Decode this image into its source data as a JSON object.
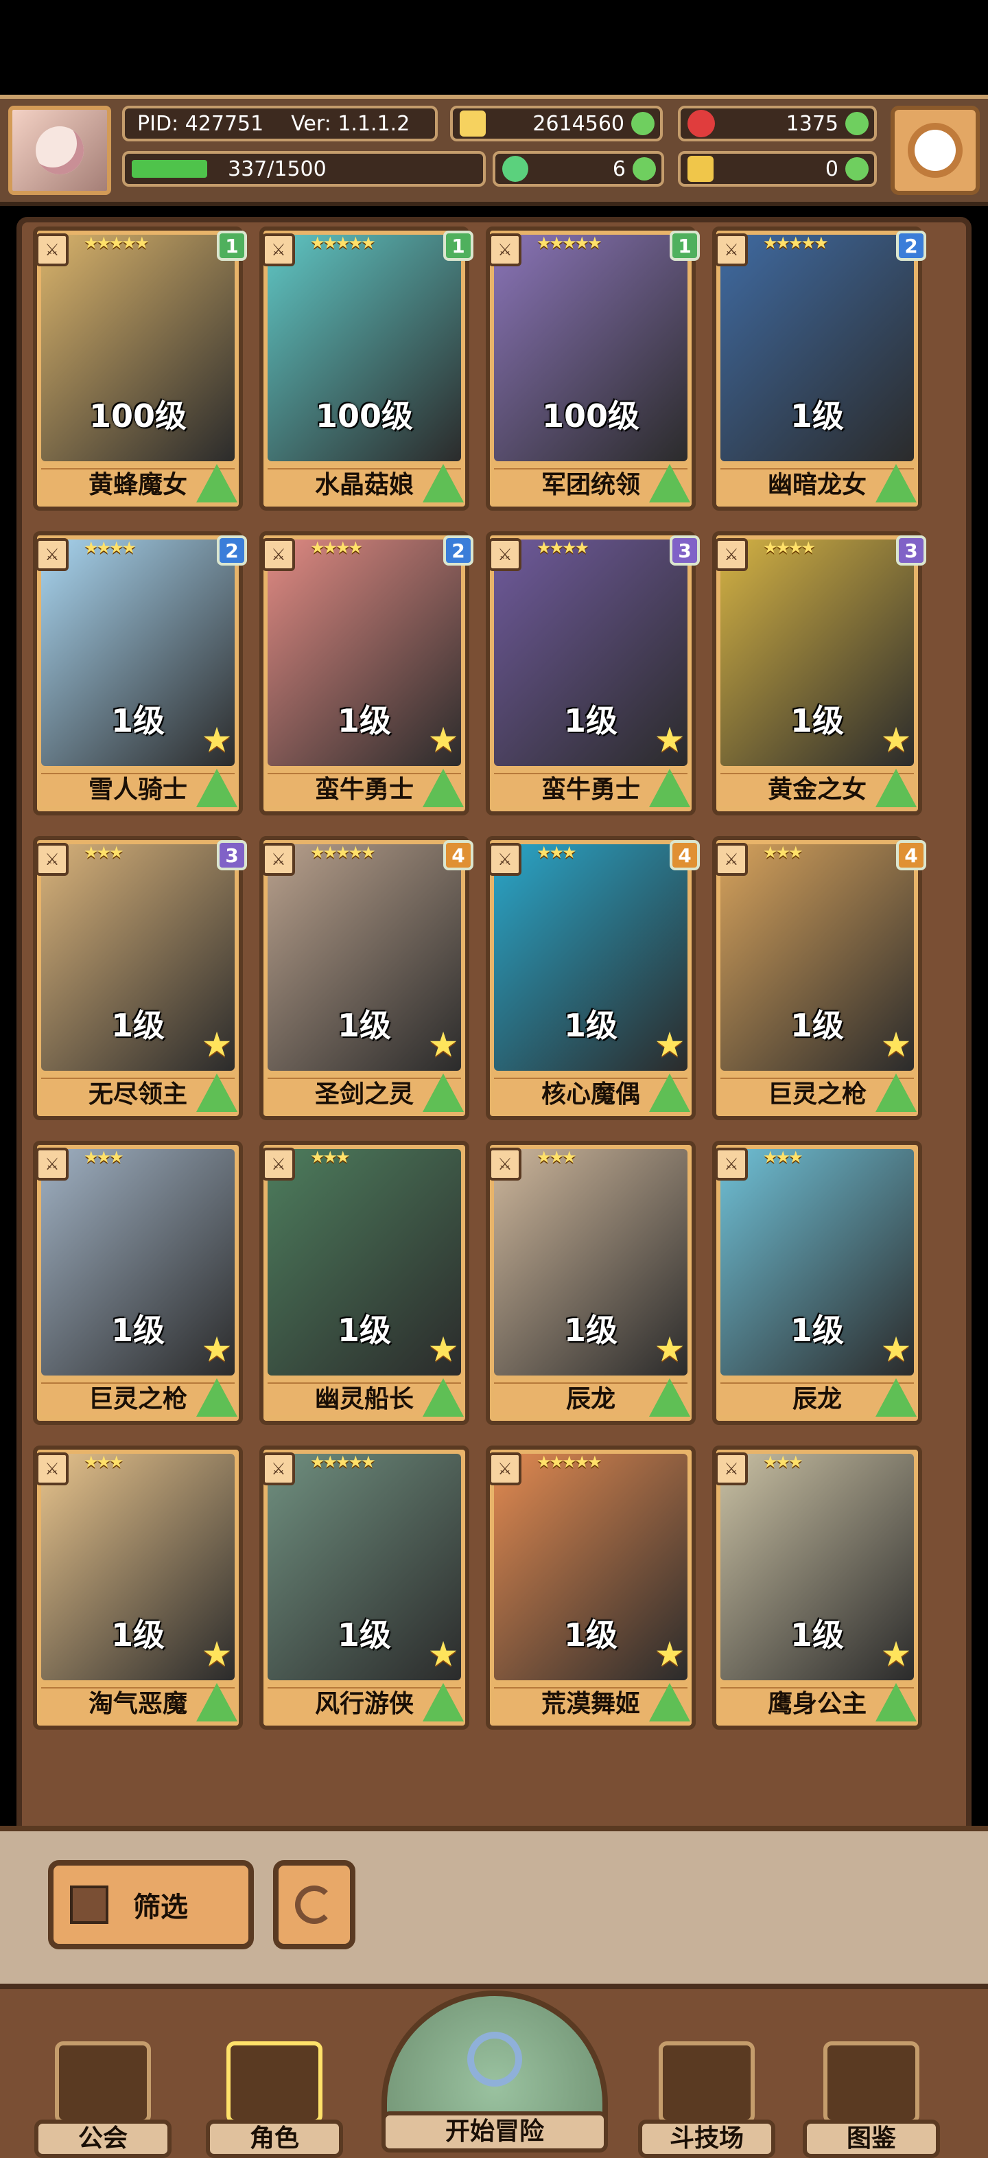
{
  "hud": {
    "pid": "PID: 427751",
    "version": "Ver: 1.1.1.2",
    "gold": "2614560",
    "gems": "1375",
    "energy": "337/1500",
    "clover": "6",
    "tickets": "0"
  },
  "cards": [
    {
      "level": "100级",
      "name": "黄蜂魔女",
      "badge": "1",
      "badge_color": "green",
      "stars": "★★★★★",
      "art": "#d9b36b"
    },
    {
      "level": "100级",
      "name": "水晶菇娘",
      "badge": "1",
      "badge_color": "green",
      "stars": "★★★★★",
      "art": "#5fc6c4"
    },
    {
      "level": "100级",
      "name": "军团统领",
      "badge": "1",
      "badge_color": "green",
      "stars": "★★★★★",
      "art": "#8a74b8"
    },
    {
      "level": "1级",
      "name": "幽暗龙女",
      "badge": "2",
      "badge_color": "blue",
      "stars": "★★★★★",
      "art": "#3f6aa1"
    },
    {
      "level": "1级",
      "name": "雪人骑士",
      "badge": "2",
      "badge_color": "blue",
      "stars": "★★★★",
      "art": "#a8d4ef"
    },
    {
      "level": "1级",
      "name": "蛮牛勇士",
      "badge": "2",
      "badge_color": "blue",
      "stars": "★★★★",
      "art": "#e08a83"
    },
    {
      "level": "1级",
      "name": "蛮牛勇士",
      "badge": "3",
      "badge_color": "purple",
      "stars": "★★★★",
      "art": "#6f5a9c"
    },
    {
      "level": "1级",
      "name": "黄金之女",
      "badge": "3",
      "badge_color": "purple",
      "stars": "★★★★",
      "art": "#d4b244"
    },
    {
      "level": "1级",
      "name": "无尽领主",
      "badge": "3",
      "badge_color": "purple",
      "stars": "★★★",
      "art": "#d8b27a"
    },
    {
      "level": "1级",
      "name": "圣剑之灵",
      "badge": "4",
      "badge_color": "orange",
      "stars": "★★★★★",
      "art": "#b8a08c"
    },
    {
      "level": "1级",
      "name": "核心魔偶",
      "badge": "4",
      "badge_color": "orange",
      "stars": "★★★",
      "art": "#2aa6c9"
    },
    {
      "level": "1级",
      "name": "巨灵之枪",
      "badge": "4",
      "badge_color": "orange",
      "stars": "★★★",
      "art": "#d6a25c"
    },
    {
      "level": "1级",
      "name": "巨灵之枪",
      "badge": "",
      "badge_color": "",
      "stars": "★★★",
      "art": "#9fb0c2"
    },
    {
      "level": "1级",
      "name": "幽灵船长",
      "badge": "",
      "badge_color": "",
      "stars": "★★★",
      "art": "#4d7d5d"
    },
    {
      "level": "1级",
      "name": "辰龙",
      "badge": "",
      "badge_color": "",
      "stars": "★★★",
      "art": "#cdb69b"
    },
    {
      "level": "1级",
      "name": "辰龙",
      "badge": "",
      "badge_color": "",
      "stars": "★★★",
      "art": "#6fc0d6"
    },
    {
      "level": "1级",
      "name": "淘气恶魔",
      "badge": "",
      "badge_color": "",
      "stars": "★★★",
      "art": "#e7c38c"
    },
    {
      "level": "1级",
      "name": "风行游侠",
      "badge": "",
      "badge_color": "",
      "stars": "★★★★★",
      "art": "#6f8f7f"
    },
    {
      "level": "1级",
      "name": "荒漠舞姬",
      "badge": "",
      "badge_color": "",
      "stars": "★★★★★",
      "art": "#e28a51"
    },
    {
      "level": "1级",
      "name": "鹰身公主",
      "badge": "",
      "badge_color": "",
      "stars": "★★★",
      "art": "#c9c0a3"
    }
  ],
  "controls": {
    "filter_label": "筛选"
  },
  "nav": {
    "guild": "公会",
    "character": "角色",
    "adventure": "开始冒险",
    "arena": "斗技场",
    "codex": "图鉴"
  }
}
